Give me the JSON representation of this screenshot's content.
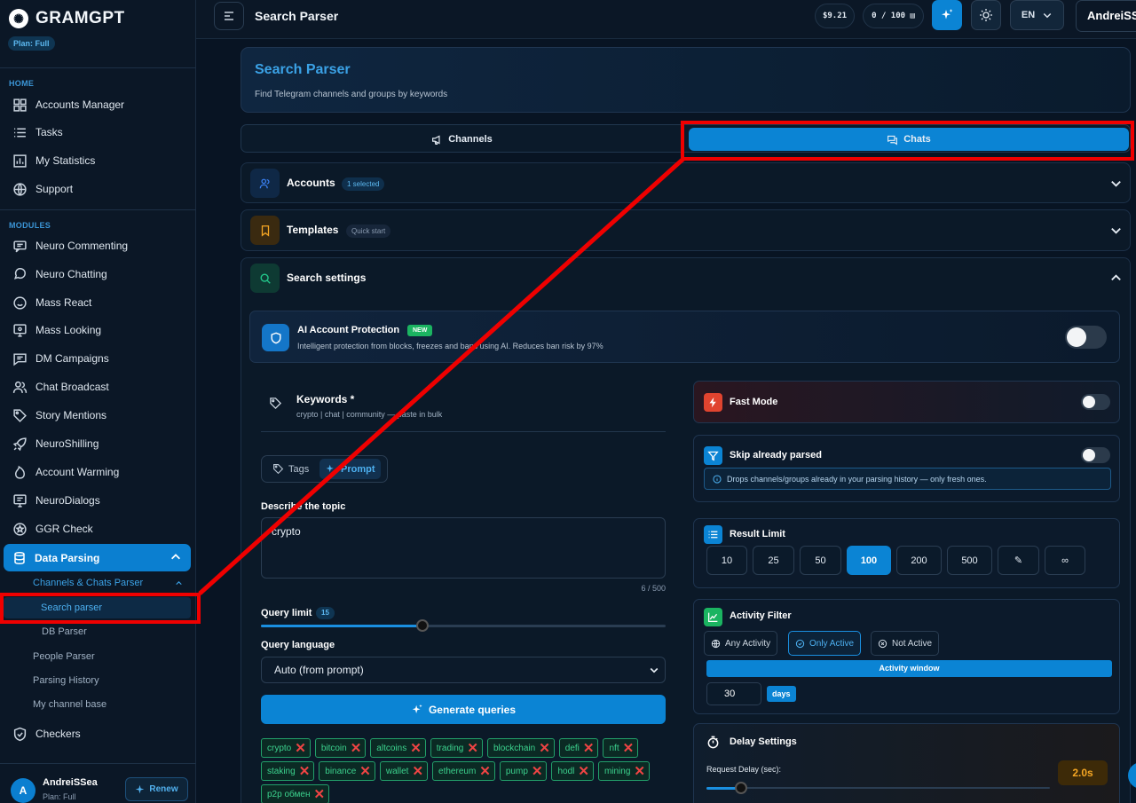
{
  "brand": {
    "name": "GRAMGPT",
    "plan": "Plan: Full"
  },
  "sidebar": {
    "home_label": "HOME",
    "home": [
      {
        "label": "Accounts Manager",
        "icon": "grid-icon"
      },
      {
        "label": "Tasks",
        "icon": "list-icon"
      },
      {
        "label": "My Statistics",
        "icon": "chart-icon"
      },
      {
        "label": "Support",
        "icon": "globe-icon"
      }
    ],
    "modules_label": "MODULES",
    "modules": [
      {
        "label": "Neuro Commenting"
      },
      {
        "label": "Neuro Chatting"
      },
      {
        "label": "Mass React"
      },
      {
        "label": "Mass Looking"
      },
      {
        "label": "DM Campaigns"
      },
      {
        "label": "Chat Broadcast"
      },
      {
        "label": "Story Mentions"
      },
      {
        "label": "NeuroShilling"
      },
      {
        "label": "Account Warming"
      },
      {
        "label": "NeuroDialogs"
      },
      {
        "label": "GGR Check"
      }
    ],
    "active": "Data Parsing",
    "sub_parent": "Channels & Chats Parser",
    "sub_selected": "Search parser",
    "subs": [
      "DB Parser",
      "People Parser",
      "Parsing History",
      "My channel base"
    ],
    "checkers": "Checkers",
    "user": {
      "initial": "A",
      "name": "AndreiSSea",
      "plan": "Plan: Full",
      "renew": "Renew"
    }
  },
  "topbar": {
    "title": "Search Parser",
    "balance": "$9.21",
    "usage": "0 / 100 ▤",
    "lang": "EN",
    "user": "AndreiSSea"
  },
  "header": {
    "title": "Search Parser",
    "subtitle": "Find Telegram channels and groups by keywords"
  },
  "tabs": {
    "channels": "Channels",
    "chats": "Chats"
  },
  "sections": {
    "accounts": {
      "title": "Accounts",
      "badge": "1 selected"
    },
    "templates": {
      "title": "Templates",
      "badge": "Quick start"
    },
    "search": {
      "title": "Search settings"
    }
  },
  "protection": {
    "title": "AI Account Protection",
    "badge": "NEW",
    "subtitle": "Intelligent protection from blocks, freezes and bans using AI. Reduces ban risk by 97%",
    "enabled": false
  },
  "keywords": {
    "title": "Keywords *",
    "hint": "crypto | chat | community — paste in bulk",
    "mode_tags": "Tags",
    "mode_prompt": "Prompt",
    "topic_label": "Describe the topic",
    "topic_value": "crypto",
    "counter": "6 / 500",
    "query_limit_label": "Query limit",
    "query_limit": "15",
    "query_limit_fraction": 0.4,
    "language_label": "Query language",
    "language_value": "Auto (from prompt)",
    "generate": "Generate queries",
    "chips": [
      "crypto",
      "bitcoin",
      "altcoins",
      "trading",
      "blockchain",
      "defi",
      "nft",
      "staking",
      "binance",
      "wallet",
      "ethereum",
      "pump",
      "hodl",
      "mining",
      "p2p обмен"
    ]
  },
  "fast_mode": {
    "title": "Fast Mode",
    "enabled": false
  },
  "skip": {
    "title": "Skip already parsed",
    "enabled": false,
    "info": "Drops channels/groups already in your parsing history — only fresh ones."
  },
  "result_limit": {
    "title": "Result Limit",
    "options": [
      "10",
      "25",
      "50",
      "100",
      "200",
      "500",
      "✎",
      "∞"
    ],
    "selected": "100"
  },
  "activity": {
    "title": "Activity Filter",
    "options": [
      "Any Activity",
      "Only Active",
      "Not Active"
    ],
    "selected": "Only Active",
    "window_label": "Activity window",
    "days_value": "30",
    "days_unit": "days"
  },
  "delay": {
    "title": "Delay Settings",
    "request_label": "Request Delay (sec):",
    "request_value": "2.0s",
    "request_fraction": 0.1
  },
  "colors": {
    "accent": "#0b84d4",
    "annotation": "#ef0000"
  }
}
